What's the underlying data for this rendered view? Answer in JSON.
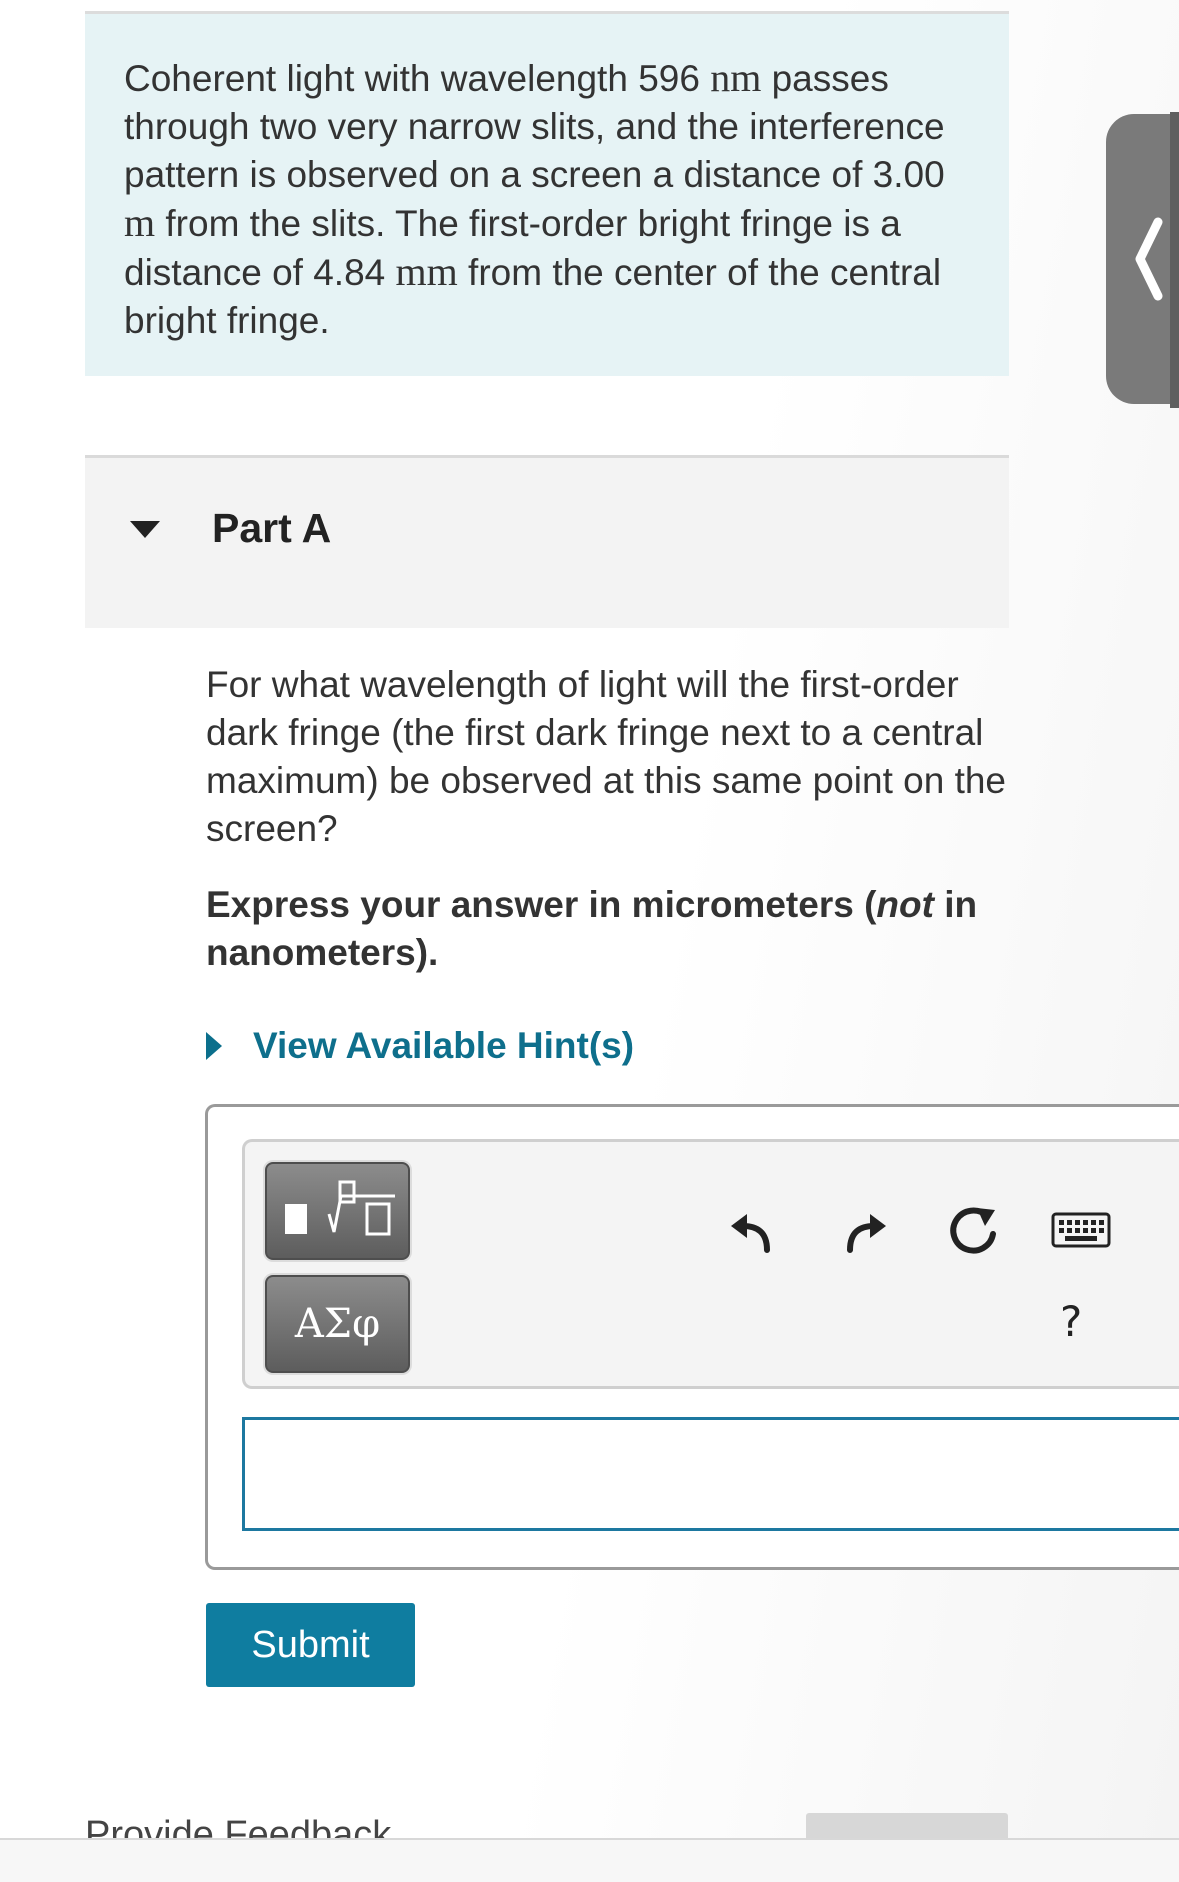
{
  "problem": {
    "text_segments": [
      {
        "text": "Coherent light with wavelength 596 ",
        "math": false
      },
      {
        "text": "nm",
        "math": true
      },
      {
        "text": " passes through two very narrow slits, and the interference pattern is observed on a screen a distance of 3.00 ",
        "math": false
      },
      {
        "text": "m",
        "math": true
      },
      {
        "text": " from the slits. The first-order bright fringe is a distance of 4.84 ",
        "math": false
      },
      {
        "text": "mm",
        "math": true
      },
      {
        "text": " from the center of the central bright fringe.",
        "math": false
      }
    ]
  },
  "part": {
    "title": "Part A",
    "question": "For what wavelength of light will the first-order dark fringe (the first dark fringe next to a central maximum) be observed at this same point on the screen?",
    "instruction_prefix": "Express your answer in micrometers (",
    "instruction_emphasis": "not",
    "instruction_suffix": " in nanometers).",
    "hints_label": "View Available Hint(s)"
  },
  "answer_tools": {
    "symbols_label": "ΑΣφ",
    "help_label": "?",
    "icons": [
      "templates-icon",
      "undo-icon",
      "redo-icon",
      "reset-icon",
      "keyboard-icon"
    ]
  },
  "answer_input": {
    "value": "",
    "placeholder": ""
  },
  "actions": {
    "submit_label": "Submit",
    "feedback_label": "Provide Feedback"
  },
  "colors": {
    "intro_bg": "#e6f3f5",
    "link": "#0e6f8c",
    "submit_bg": "#0f7da0",
    "input_border": "#1d78a0",
    "side_tab": "#7a7a7a"
  }
}
